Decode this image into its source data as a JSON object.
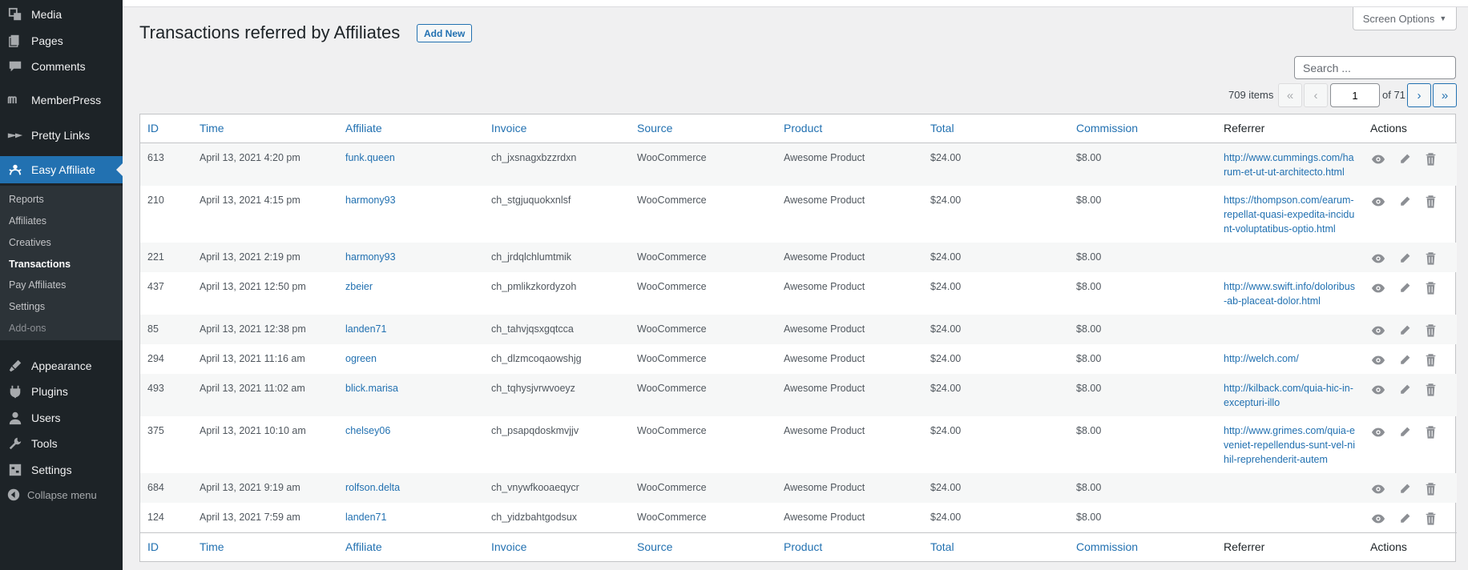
{
  "sidebar": {
    "items": [
      {
        "label": "Media",
        "icon": "media-icon"
      },
      {
        "label": "Pages",
        "icon": "pages-icon"
      },
      {
        "label": "Comments",
        "icon": "comments-icon"
      },
      {
        "label": "MemberPress",
        "icon": "memberpress-icon"
      },
      {
        "label": "Pretty Links",
        "icon": "pretty-links-icon"
      },
      {
        "label": "Easy Affiliate",
        "icon": "easy-affiliate-icon"
      },
      {
        "label": "Appearance",
        "icon": "appearance-icon"
      },
      {
        "label": "Plugins",
        "icon": "plugins-icon"
      },
      {
        "label": "Users",
        "icon": "users-icon"
      },
      {
        "label": "Tools",
        "icon": "tools-icon"
      },
      {
        "label": "Settings",
        "icon": "settings-icon"
      }
    ],
    "submenu": [
      "Reports",
      "Affiliates",
      "Creatives",
      "Transactions",
      "Pay Affiliates",
      "Settings",
      "Add-ons"
    ],
    "collapse_label": "Collapse menu"
  },
  "screen_options_label": "Screen Options",
  "page_title": "Transactions referred by Affiliates",
  "add_new_label": "Add New",
  "search": {
    "placeholder": "Search ..."
  },
  "pagination": {
    "items": "709 items",
    "first": "«",
    "prev": "‹",
    "current": "1",
    "of": "of 71",
    "next": "›",
    "last": "»"
  },
  "table": {
    "columns": [
      "ID",
      "Time",
      "Affiliate",
      "Invoice",
      "Source",
      "Product",
      "Total",
      "Commission",
      "Referrer",
      "Actions"
    ],
    "rows": [
      {
        "id": "613",
        "time": "April 13, 2021 4:20 pm",
        "affiliate": "funk.queen",
        "invoice": "ch_jxsnagxbzzrdxn",
        "source": "WooCommerce",
        "product": "Awesome Product",
        "total": "$24.00",
        "commission": "$8.00",
        "referrer": "http://www.cummings.com/harum-et-ut-ut-architecto.html"
      },
      {
        "id": "210",
        "time": "April 13, 2021 4:15 pm",
        "affiliate": "harmony93",
        "invoice": "ch_stgjuquokxnlsf",
        "source": "WooCommerce",
        "product": "Awesome Product",
        "total": "$24.00",
        "commission": "$8.00",
        "referrer": "https://thompson.com/earum-repellat-quasi-expedita-incidunt-voluptatibus-optio.html"
      },
      {
        "id": "221",
        "time": "April 13, 2021 2:19 pm",
        "affiliate": "harmony93",
        "invoice": "ch_jrdqlchlumtmik",
        "source": "WooCommerce",
        "product": "Awesome Product",
        "total": "$24.00",
        "commission": "$8.00",
        "referrer": ""
      },
      {
        "id": "437",
        "time": "April 13, 2021 12:50 pm",
        "affiliate": "zbeier",
        "invoice": "ch_pmlikzkordyzoh",
        "source": "WooCommerce",
        "product": "Awesome Product",
        "total": "$24.00",
        "commission": "$8.00",
        "referrer": "http://www.swift.info/doloribus-ab-placeat-dolor.html"
      },
      {
        "id": "85",
        "time": "April 13, 2021 12:38 pm",
        "affiliate": "landen71",
        "invoice": "ch_tahvjqsxgqtcca",
        "source": "WooCommerce",
        "product": "Awesome Product",
        "total": "$24.00",
        "commission": "$8.00",
        "referrer": ""
      },
      {
        "id": "294",
        "time": "April 13, 2021 11:16 am",
        "affiliate": "ogreen",
        "invoice": "ch_dlzmcoqaowshjg",
        "source": "WooCommerce",
        "product": "Awesome Product",
        "total": "$24.00",
        "commission": "$8.00",
        "referrer": "http://welch.com/"
      },
      {
        "id": "493",
        "time": "April 13, 2021 11:02 am",
        "affiliate": "blick.marisa",
        "invoice": "ch_tqhysjvrwvoeyz",
        "source": "WooCommerce",
        "product": "Awesome Product",
        "total": "$24.00",
        "commission": "$8.00",
        "referrer": "http://kilback.com/quia-hic-in-excepturi-illo"
      },
      {
        "id": "375",
        "time": "April 13, 2021 10:10 am",
        "affiliate": "chelsey06",
        "invoice": "ch_psapqdoskmvjjv",
        "source": "WooCommerce",
        "product": "Awesome Product",
        "total": "$24.00",
        "commission": "$8.00",
        "referrer": "http://www.grimes.com/quia-eveniet-repellendus-sunt-vel-nihil-reprehenderit-autem"
      },
      {
        "id": "684",
        "time": "April 13, 2021 9:19 am",
        "affiliate": "rolfson.delta",
        "invoice": "ch_vnywfkooaeqycr",
        "source": "WooCommerce",
        "product": "Awesome Product",
        "total": "$24.00",
        "commission": "$8.00",
        "referrer": ""
      },
      {
        "id": "124",
        "time": "April 13, 2021 7:59 am",
        "affiliate": "landen71",
        "invoice": "ch_yidzbahtgodsux",
        "source": "WooCommerce",
        "product": "Awesome Product",
        "total": "$24.00",
        "commission": "$8.00",
        "referrer": ""
      }
    ]
  },
  "colors": {
    "accent": "#2271b1",
    "sidebar_bg": "#1d2327",
    "submenu_bg": "#2c3338"
  }
}
